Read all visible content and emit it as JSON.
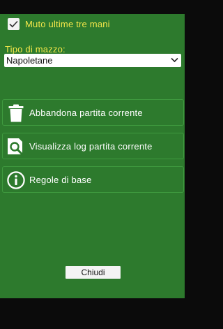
{
  "options": {
    "mute_last_three_hands": {
      "label": "Muto ultime tre mani",
      "checked": true
    }
  },
  "deck": {
    "label": "Tipo di mazzo:",
    "selected": "Napoletane"
  },
  "actions": [
    {
      "label": "Abbandona partita corrente",
      "icon": "trash-icon"
    },
    {
      "label": "Visualizza log partita corrente",
      "icon": "magnifier-icon"
    },
    {
      "label": "Regole di base",
      "icon": "info-icon"
    }
  ],
  "footer": {
    "close_label": "Chiudi"
  },
  "colors": {
    "panel": "#2d7a2d",
    "label_yellow": "#f2e64a",
    "background": "#0b0b0b"
  }
}
